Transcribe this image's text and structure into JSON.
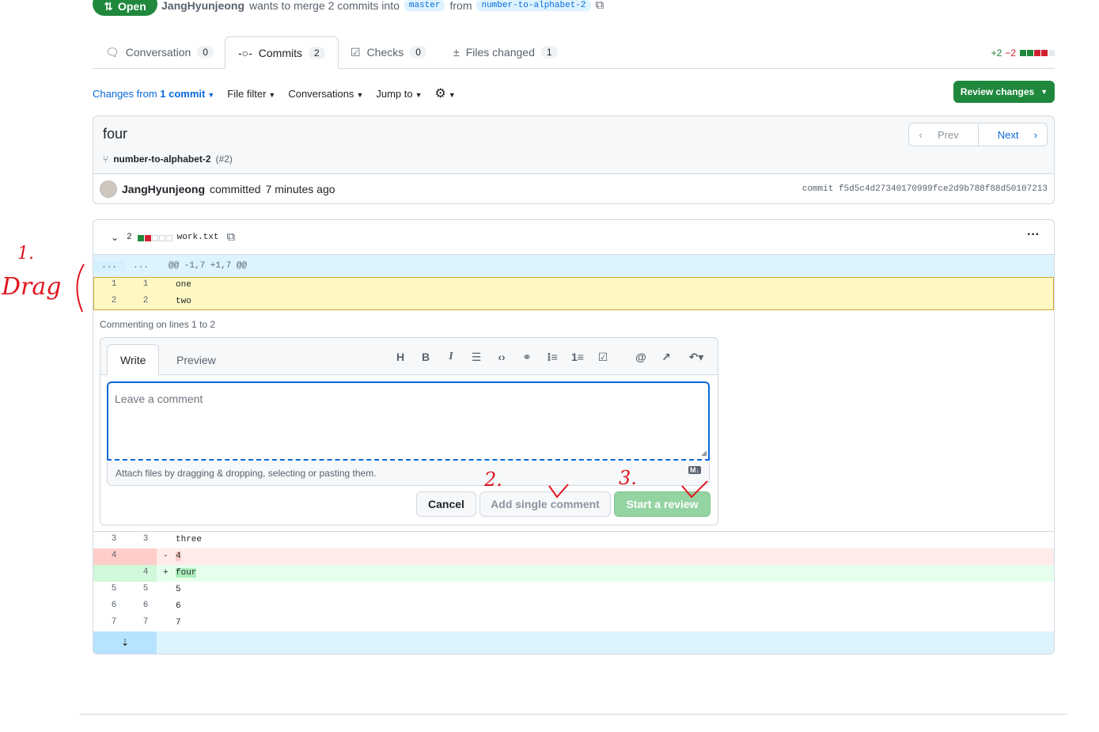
{
  "header": {
    "status": "Open",
    "author": "JangHyunjeong",
    "merge_text_1": "wants to merge 2 commits into",
    "base_branch": "master",
    "merge_text_2": "from",
    "head_branch": "number-to-alphabet-2"
  },
  "tabs": [
    {
      "label": "Conversation",
      "count": "0"
    },
    {
      "label": "Commits",
      "count": "2"
    },
    {
      "label": "Checks",
      "count": "0"
    },
    {
      "label": "Files changed",
      "count": "1"
    }
  ],
  "diffstat": {
    "additions": "+2",
    "deletions": "−2"
  },
  "toolbar": {
    "changes_from": "Changes from",
    "commit_count": "1 commit",
    "file_filter": "File filter",
    "conversations": "Conversations",
    "jump_to": "Jump to",
    "review_changes": "Review changes"
  },
  "commit": {
    "title": "four",
    "branch": "number-to-alphabet-2",
    "pr_ref": "(#2)",
    "prev": "Prev",
    "next": "Next",
    "author": "JangHyunjeong",
    "committed": "committed",
    "time": "7 minutes ago",
    "sha_label": "commit",
    "sha": "f5d5c4d27340170999fce2d9b788f88d50107213"
  },
  "file": {
    "changes": "2",
    "name": "work.txt",
    "hunk_left": "...",
    "hunk_right": "...",
    "hunk_header": "@@ -1,7 +1,7 @@"
  },
  "lines_top": [
    {
      "old": "1",
      "new": "1",
      "code": "one"
    },
    {
      "old": "2",
      "new": "2",
      "code": "two"
    }
  ],
  "comment": {
    "commenting_on": "Commenting on lines 1 to 2",
    "write": "Write",
    "preview": "Preview",
    "placeholder": "Leave a comment",
    "attach": "Attach files by dragging & dropping, selecting or pasting them.",
    "cancel": "Cancel",
    "add_single": "Add single comment",
    "start_review": "Start a review"
  },
  "lines_bottom": [
    {
      "old": "3",
      "new": "3",
      "sign": "",
      "code": "three",
      "type": "ctx"
    },
    {
      "old": "4",
      "new": "",
      "sign": "-",
      "code": "4",
      "type": "del"
    },
    {
      "old": "",
      "new": "4",
      "sign": "+",
      "code": "four",
      "type": "add"
    },
    {
      "old": "5",
      "new": "5",
      "sign": "",
      "code": "5",
      "type": "ctx"
    },
    {
      "old": "6",
      "new": "6",
      "sign": "",
      "code": "6",
      "type": "ctx"
    },
    {
      "old": "7",
      "new": "7",
      "sign": "",
      "code": "7",
      "type": "ctx"
    }
  ],
  "annotations": {
    "step1_num": "1.",
    "step1_text": "Drag",
    "step2": "2.",
    "step3": "3."
  },
  "colors": {
    "accent": "#0969da",
    "success": "#1f883d",
    "danger": "#cf222e",
    "annotation": "#e0151f"
  }
}
